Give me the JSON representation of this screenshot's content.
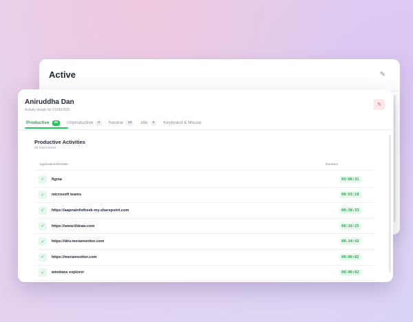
{
  "back_modal": {
    "title": "Active",
    "close_glyph": "✎"
  },
  "front_modal": {
    "user_name": "Aniruddha Dan",
    "subtitle": "Activity details for 01/08/2025",
    "close_glyph": "✎",
    "tabs": [
      {
        "label": "Productive",
        "count": "26"
      },
      {
        "label": "Unproductive",
        "count": "0"
      },
      {
        "label": "Neutral",
        "count": "14"
      },
      {
        "label": "Idle",
        "count": "2"
      },
      {
        "label": "Keyboard & Mouse"
      }
    ],
    "section": {
      "title": "Productive Activities",
      "subtitle": "26 total entries"
    },
    "table": {
      "col_app": "Application/Website",
      "col_duration": "Duration",
      "rows": [
        {
          "name": "figma",
          "duration": "03:06:31"
        },
        {
          "name": "microsoft teams",
          "duration": "00:53:18"
        },
        {
          "name": "https://aapnainfotheek-my.sharepoint.com",
          "duration": "00:38:33"
        },
        {
          "name": "https://www.tldraw.com",
          "duration": "00:16:25"
        },
        {
          "name": "https://dev.meramonitor.com",
          "duration": "00:14:42"
        },
        {
          "name": "https://meramonitor.com",
          "duration": "00:06:02"
        },
        {
          "name": "windows explorer",
          "duration": "00:06:02"
        }
      ]
    }
  },
  "icons": {
    "check": "✓"
  },
  "colors": {
    "accent_green": "#22c55e",
    "close_red": "#e0485e"
  }
}
